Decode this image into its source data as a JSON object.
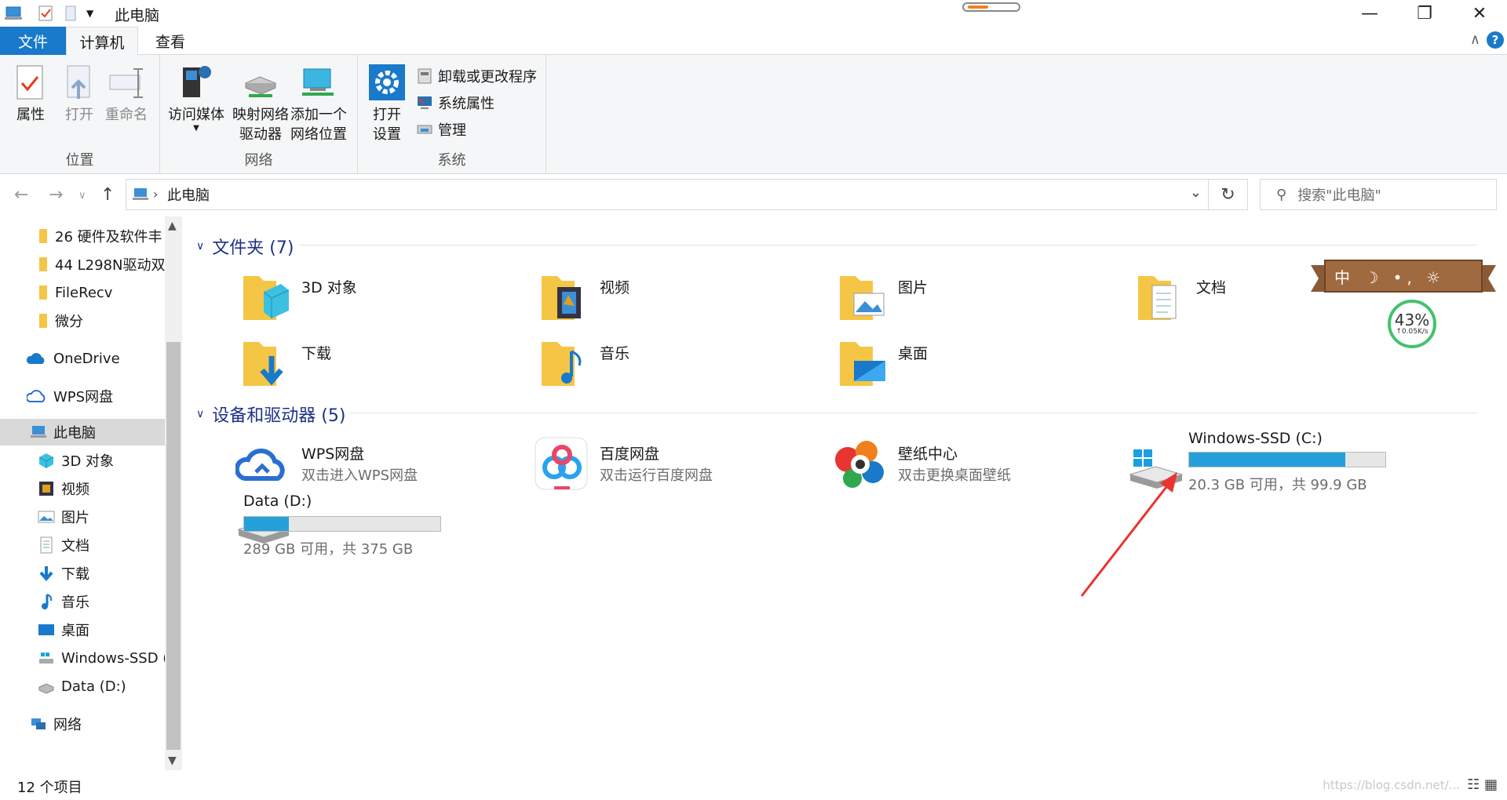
{
  "window": {
    "title": "此电脑",
    "minimize": "—",
    "maximize": "❐",
    "close": "✕"
  },
  "tabs": {
    "file": "文件",
    "computer": "计算机",
    "view": "查看",
    "help": "?"
  },
  "ribbon": {
    "location_group": {
      "label": "位置",
      "properties": "属性",
      "open": "打开",
      "rename": "重命名"
    },
    "network_group": {
      "label": "网络",
      "access_media": "访问媒体",
      "map_drive_1": "映射网络",
      "map_drive_2": "驱动器",
      "add_location_1": "添加一个",
      "add_location_2": "网络位置"
    },
    "system_group": {
      "label": "系统",
      "open_settings_1": "打开",
      "open_settings_2": "设置",
      "uninstall": "卸载或更改程序",
      "sys_props": "系统属性",
      "manage": "管理"
    }
  },
  "address": {
    "path": "此电脑",
    "search_placeholder": "搜索\"此电脑\""
  },
  "sidebar": {
    "items": [
      {
        "label": "26 硬件及软件丰"
      },
      {
        "label": "44 L298N驱动双"
      },
      {
        "label": "FileRecv"
      },
      {
        "label": "微分"
      },
      {
        "label": "OneDrive"
      },
      {
        "label": "WPS网盘"
      },
      {
        "label": "此电脑"
      },
      {
        "label": "3D 对象"
      },
      {
        "label": "视频"
      },
      {
        "label": "图片"
      },
      {
        "label": "文档"
      },
      {
        "label": "下载"
      },
      {
        "label": "音乐"
      },
      {
        "label": "桌面"
      },
      {
        "label": "Windows-SSD ("
      },
      {
        "label": "Data (D:)"
      },
      {
        "label": "网络"
      }
    ]
  },
  "folders": {
    "header": "文件夹 (7)",
    "items": [
      {
        "name": "3D 对象"
      },
      {
        "name": "视频"
      },
      {
        "name": "图片"
      },
      {
        "name": "文档"
      },
      {
        "name": "下载"
      },
      {
        "name": "音乐"
      },
      {
        "name": "桌面"
      }
    ]
  },
  "devices": {
    "header": "设备和驱动器 (5)",
    "wps": {
      "name": "WPS网盘",
      "sub": "双击进入WPS网盘"
    },
    "baidu": {
      "name": "百度网盘",
      "sub": "双击运行百度网盘"
    },
    "wallpaper": {
      "name": "壁纸中心",
      "sub": "双击更换桌面壁纸"
    },
    "c_drive": {
      "name": "Windows-SSD (C:)",
      "info": "20.3 GB 可用，共 99.9 GB",
      "used_fraction": 0.797
    },
    "d_drive": {
      "name": "Data (D:)",
      "info": "289 GB 可用，共 375 GB",
      "used_fraction": 0.229
    }
  },
  "widget": {
    "tabs_text": "中 ☽ •, ☼",
    "percent": "43%",
    "speed": "↑0.05K/s"
  },
  "status": {
    "count": "12 个项目",
    "watermark": "https://blog.csdn.net/..."
  },
  "colors": {
    "accent": "#1979ca",
    "bar_fill": "#26a0da",
    "section_text": "#1e3287",
    "arrow": "#e8352f"
  }
}
